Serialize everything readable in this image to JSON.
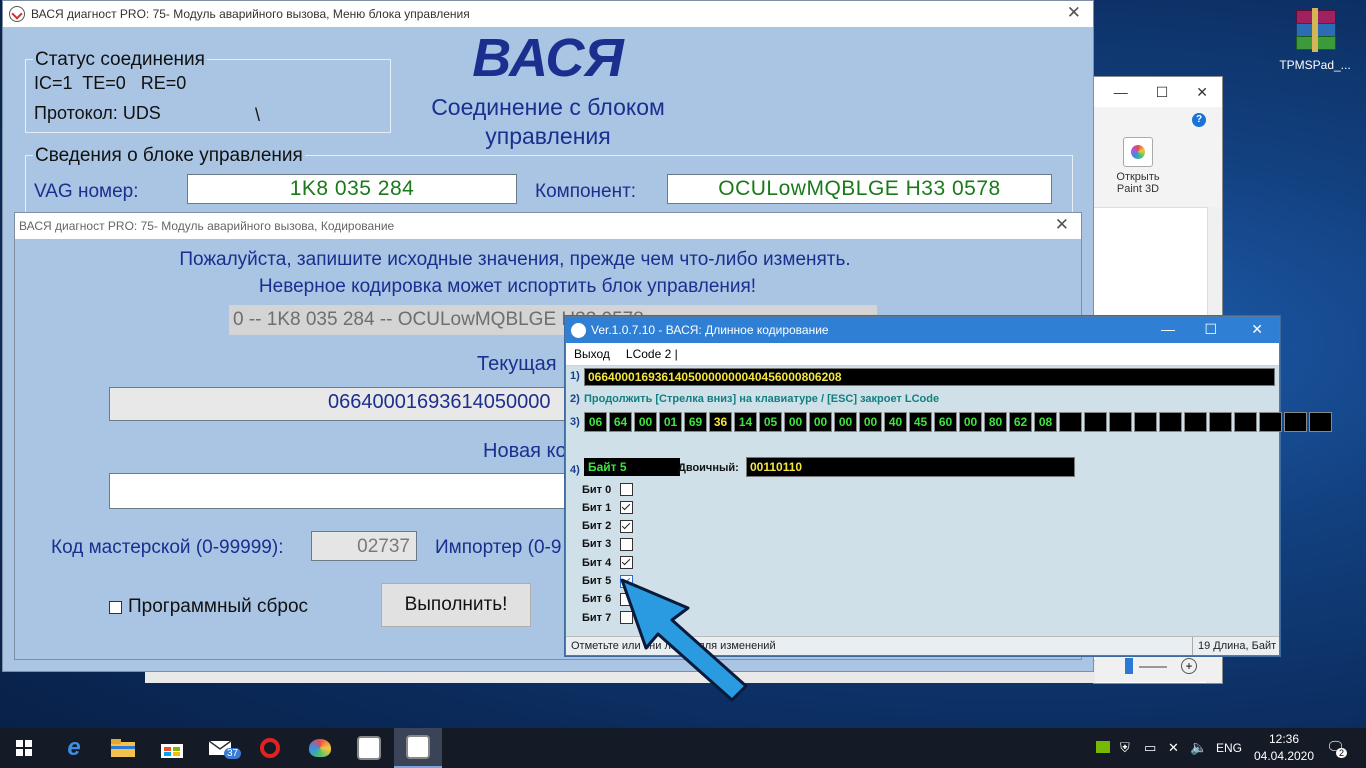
{
  "desktop": {
    "icon_label": "TPMSPad_..."
  },
  "explorer": {
    "paint3d_label": "Открыть Paint 3D"
  },
  "main": {
    "title": "ВАСЯ диагност PRO: 75- Модуль аварийного вызова,  Меню блока управления",
    "status_group": "Статус соединения",
    "status_line": "IC=1  TE=0   RE=0",
    "protocol": "Протокол: UDS",
    "spinner": "\\",
    "logo": "ВАСЯ",
    "connection": "Соединение с блоком управления",
    "info_group": "Сведения о блоке управления",
    "vag_label": "VAG номер:",
    "vag_value": "1K8 035 284",
    "component_label": "Компонент:",
    "component_value": "OCULowMQBLGE  H33 0578"
  },
  "coding": {
    "title": "ВАСЯ диагност PRO: 75- Модуль аварийного вызова,  Кодирование",
    "warning1": "Пожалуйста, запишите исходные значения, прежде чем что-либо изменять.",
    "warning2": "Неверное кодировка может испортить блок управления!",
    "unit_line": "0 -- 1K8 035 284  -- OCULowMQBLGE  H33 0578",
    "current_label": "Текущая",
    "current_value": "06640001693614050000",
    "new_label": "Новая ко",
    "new_value": "",
    "workshop_label": "Код мастерской (0-99999):",
    "workshop_value": "02737",
    "importer_label": "Импортер (0-9",
    "reset_label": "Программный сброс",
    "execute_label": "Выполнить!"
  },
  "lcode": {
    "title": "Ver.1.0.7.10 - ВАСЯ: Длинное кодирование",
    "menu_exit": "Выход",
    "menu_lcode": "LCode 2 |",
    "n1": "1)",
    "n2": "2)",
    "n3": "3)",
    "n4": "4)",
    "full_code": "0664000169361405000000004045600080620​8",
    "hint": "Продолжить [Стрелка вниз] на клавиатуре / [ESC] закроет LCode",
    "bytes": [
      "06",
      "64",
      "00",
      "01",
      "69",
      "36",
      "14",
      "05",
      "00",
      "00",
      "00",
      "00",
      "40",
      "45",
      "60",
      "00",
      "80",
      "62",
      "08",
      "",
      "",
      "",
      "",
      "",
      "",
      "",
      "",
      "",
      "",
      ""
    ],
    "selected_byte_index": 5,
    "byte_label": "Байт 5",
    "binary_label": "Двоичный:",
    "binary_value": "00110110",
    "bits": [
      {
        "label": "Бит 0",
        "checked": false
      },
      {
        "label": "Бит 1",
        "checked": true
      },
      {
        "label": "Бит 2",
        "checked": true
      },
      {
        "label": "Бит 3",
        "checked": false
      },
      {
        "label": "Бит 4",
        "checked": true
      },
      {
        "label": "Бит 5",
        "checked": true
      },
      {
        "label": "Бит 6",
        "checked": false
      },
      {
        "label": "Бит 7",
        "checked": false
      }
    ],
    "status_left": "Отметьте или сни       лажок для изменений",
    "status_right": "19 Длина, Байт"
  },
  "taskbar": {
    "mail_badge": "37",
    "lang": "ENG",
    "time": "12:36",
    "date": "04.04.2020",
    "notif_count": "2"
  },
  "colors": {
    "accent_arrow": "#2a9be0",
    "lcd_green": "#1a7a1a",
    "code_yellow": "#f3e63c"
  }
}
